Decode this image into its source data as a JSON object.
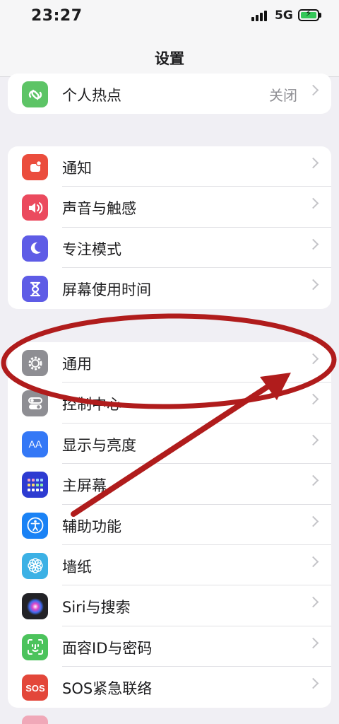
{
  "status": {
    "time": "23:27",
    "network": "5G",
    "battery_color": "#34c759"
  },
  "nav": {
    "title": "设置"
  },
  "groups": [
    {
      "items": [
        {
          "label": "个人热点",
          "value": "关闭",
          "icon": "hotspot-icon",
          "color": "#5dc466"
        }
      ]
    },
    {
      "items": [
        {
          "label": "通知",
          "icon": "bell-icon",
          "color": "#eb4d3d"
        },
        {
          "label": "声音与触感",
          "icon": "speaker-icon",
          "color": "#eb4a5e"
        },
        {
          "label": "专注模式",
          "icon": "moon-icon",
          "color": "#5e5ce6"
        },
        {
          "label": "屏幕使用时间",
          "icon": "hourglass-icon",
          "color": "#5e5ce6"
        }
      ]
    },
    {
      "items": [
        {
          "label": "通用",
          "icon": "gear-icon",
          "color": "#8e8e93"
        },
        {
          "label": "控制中心",
          "icon": "toggle-icon",
          "color": "#8e8e93"
        },
        {
          "label": "显示与亮度",
          "icon": "display-icon",
          "color": "#3478f6"
        },
        {
          "label": "主屏幕",
          "icon": "home-grid-icon",
          "color": "#2d3bd1"
        },
        {
          "label": "辅助功能",
          "icon": "accessibility-icon",
          "color": "#1a82f5"
        },
        {
          "label": "墙纸",
          "icon": "flower-icon",
          "color": "#3cb1e5"
        },
        {
          "label": "Siri与搜索",
          "icon": "siri-icon",
          "color": "#222226"
        },
        {
          "label": "面容ID与密码",
          "icon": "faceid-icon",
          "color": "#4cc35c"
        },
        {
          "label": "SOS紧急联络",
          "icon": "sos-icon",
          "color": "#e3473a"
        }
      ]
    }
  ],
  "annotation": {
    "highlight_color": "#b01c1c"
  }
}
